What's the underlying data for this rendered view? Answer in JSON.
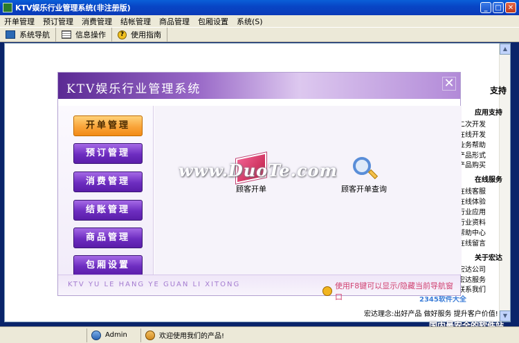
{
  "window": {
    "title": "KTV娱乐行业管理系统(非注册版)"
  },
  "menubar": [
    "开单管理",
    "预订管理",
    "消费管理",
    "结帐管理",
    "商品管理",
    "包厢设置",
    "系统(S)"
  ],
  "toolbar": {
    "nav_label": "系统导航",
    "info_label": "信息操作",
    "guide_label": "使用指南"
  },
  "dialog": {
    "title": "KTV娱乐行业管理系统",
    "close_glyph": "✕",
    "side_buttons": [
      "开单管理",
      "预订管理",
      "消费管理",
      "结账管理",
      "商品管理",
      "包厢设置"
    ],
    "active_index": 0,
    "content_items": [
      {
        "label": "顾客开单",
        "icon": "book-icon"
      },
      {
        "label": "顾客开单查询",
        "icon": "search-icon"
      }
    ],
    "footer_pinyin": "KTV YU LE HANG YE GUAN LI XITONG",
    "footer_hint": "使用F8键可以显示/隐藏当前导航窗口"
  },
  "rightpanel": {
    "title_fragment": "支持",
    "section1_header": "应用支持",
    "section1_items": [
      "二次开发",
      "在线开发",
      "业务帮助",
      "产品形式",
      "产品购买"
    ],
    "section2_header": "在线服务",
    "section2_items": [
      "在线客服",
      "在线体验",
      "行业应用",
      "行业资料",
      "帮助中心",
      "在线留言"
    ],
    "section3_header": "关于宏达",
    "section3_items": [
      "宏达公司",
      "宏达服务",
      "联系我们"
    ]
  },
  "slogan": "宏达理念:出好产品 做好服务 提升客户价值!",
  "watermarks": {
    "site": "www.DuoTe.com",
    "logo": "2345软件大全",
    "cn": "国内最安全的软件站"
  },
  "statusbar": {
    "user": "Admin",
    "welcome": "欢迎使用我们的产品!"
  }
}
